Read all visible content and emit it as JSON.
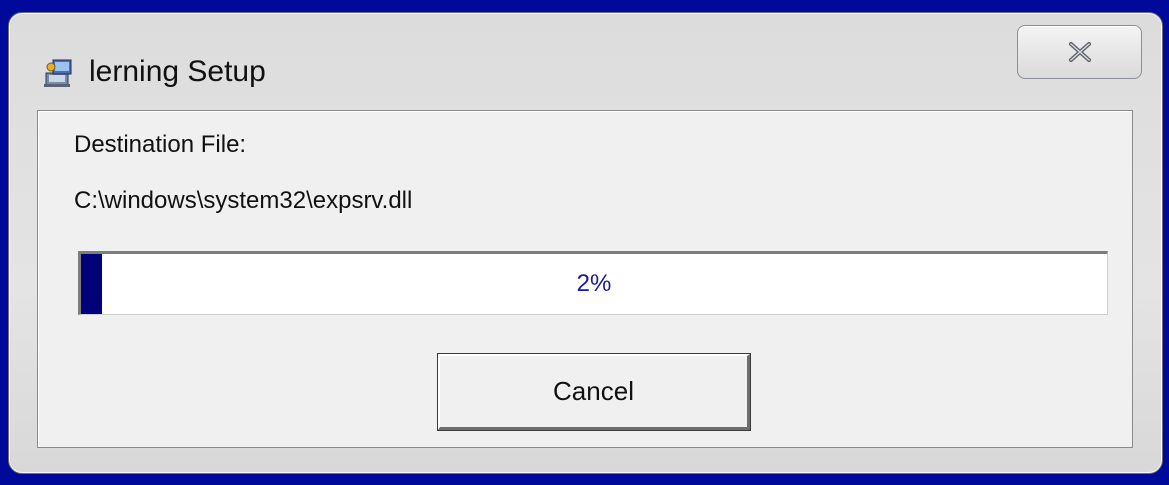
{
  "window": {
    "title": "lerning Setup",
    "icon": "setup-computer-icon",
    "close_icon": "close-icon"
  },
  "content": {
    "destination_label": "Destination File:",
    "destination_path": "C:\\windows\\system32\\expsrv.dll"
  },
  "progress": {
    "value": 2,
    "label": "2%",
    "fill_color": "#00007a",
    "text_color": "#1a1a9a"
  },
  "buttons": {
    "cancel_label": "Cancel"
  },
  "colors": {
    "desktop_background": "#000a9a"
  }
}
